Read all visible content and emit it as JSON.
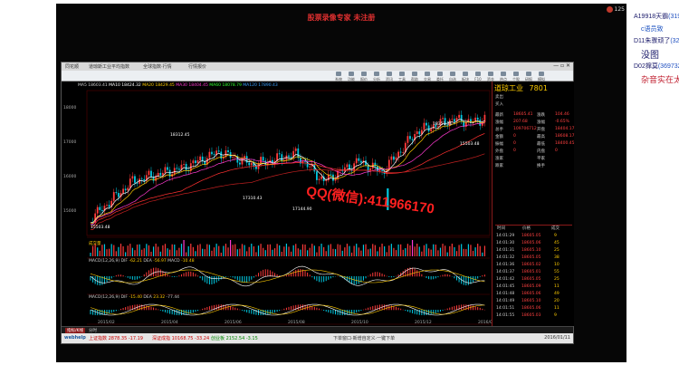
{
  "video": {
    "caption": "股票录像专家 未注册",
    "control_text": "125"
  },
  "window": {
    "title_left": "同花顺",
    "title_mid": "道琼斯工业平均指数",
    "title_mid2": "全球指数·行情",
    "title_right": "行情报价"
  },
  "menu": [
    "系统",
    "功能",
    "报价",
    "分析",
    "资讯",
    "工具",
    "帮助",
    "交易",
    "委托",
    "自选",
    "板块",
    "F10",
    "资金",
    "热点",
    "个股",
    "研报",
    "模拟",
    "更多"
  ],
  "chart": {
    "ma_legend": [
      "MA5",
      "18603.41",
      "MA10",
      "18424.32",
      "MA20",
      "18429.45",
      "MA30",
      "18404.45",
      "MA60",
      "18078.79",
      "MA120",
      "17890.43"
    ],
    "annotations": [
      "18312.45",
      "17310.43",
      "17144.90",
      "15503.48",
      "18351.36",
      "15503.48"
    ],
    "overlay_text": "QQ(微信):411966170",
    "volume_label": "成交量",
    "macd_label": "MACD(12,26,9)",
    "macd_values": [
      "DIF",
      "-62.21",
      "DEA",
      "-56.97",
      "MACD",
      "-10.48"
    ],
    "macd2_label": "MACD(12,26,9)",
    "macd2_values": [
      "DIF",
      "-15.40",
      "DEA",
      "23.32",
      "-77.44"
    ],
    "x_ticks": [
      "2015/02",
      "2015/04",
      "2015/06",
      "2015/08",
      "2015/10",
      "2015/12",
      "2016/02"
    ],
    "y_ticks": [
      "18000",
      "17000",
      "16000",
      "15000"
    ]
  },
  "right_panel": {
    "name": "道琼工业",
    "code": "7801",
    "bid_label": "卖出",
    "ask_label": "买入",
    "rows": [
      [
        "最新",
        "18605.41",
        "涨跌",
        "104.46"
      ],
      [
        "涨幅",
        "207.68",
        "涨幅",
        "-0.65%"
      ],
      [
        "总手",
        "109706712",
        "开盘",
        "18404.17"
      ],
      [
        "金额",
        "0",
        "最高",
        "18608.17"
      ],
      [
        "振幅",
        "0",
        "最低",
        "18400.45"
      ],
      [
        "外盘",
        "0",
        "内盘",
        "0"
      ],
      [
        "涨家",
        "",
        "平家",
        ""
      ],
      [
        "跌家",
        "",
        "换手",
        ""
      ]
    ],
    "sub_header": [
      "时间",
      "价格",
      "成交"
    ],
    "trades": [
      [
        "14:01:29",
        "18605.05",
        "9"
      ],
      [
        "14:01:30",
        "18605.06",
        "45"
      ],
      [
        "14:01:31",
        "18605.10",
        "25"
      ],
      [
        "14:01:32",
        "18605.05",
        "38"
      ],
      [
        "14:01:36",
        "18605.02",
        "10"
      ],
      [
        "14:01:37",
        "18605.01",
        "55"
      ],
      [
        "14:01:42",
        "18605.05",
        "25"
      ],
      [
        "14:01:45",
        "18605.09",
        "11"
      ],
      [
        "14:01:48",
        "18605.06",
        "49"
      ],
      [
        "14:01:49",
        "18605.10",
        "20"
      ],
      [
        "14:01:51",
        "18605.06",
        "11"
      ],
      [
        "14:01:55",
        "18605.03",
        "9"
      ]
    ]
  },
  "status": {
    "left": "上证指数 2878.35 -17.19",
    "mid": "深证成指 10168.75 -33.24",
    "mid2": "创业板 2152.54 -3.15",
    "notice": "下单窗口·新增自定义·一键下单",
    "time": "2016/01/11"
  },
  "bottom_tabs": [
    "指标/K线",
    "分时"
  ],
  "chat": {
    "line1_name": "A19918天霸",
    "line1_id": "(319",
    "line2": "c语员致",
    "line3_name": "D11朱骤",
    "line3_suffix": "顽了",
    "line3_id": "(322",
    "line4": "没图",
    "line5_name": "D02撺莫",
    "line5_id": "(369732",
    "line6": "杂音实在太"
  },
  "colors": {
    "candle_up": "#ff3a3a",
    "candle_down": "#00c8e0",
    "ma1": "#ffffff",
    "ma2": "#ffcc00",
    "ma3": "#ff3ad0",
    "ma4": "#30ff30",
    "overlay": "#ff2020",
    "accent_red": "#c00000"
  }
}
